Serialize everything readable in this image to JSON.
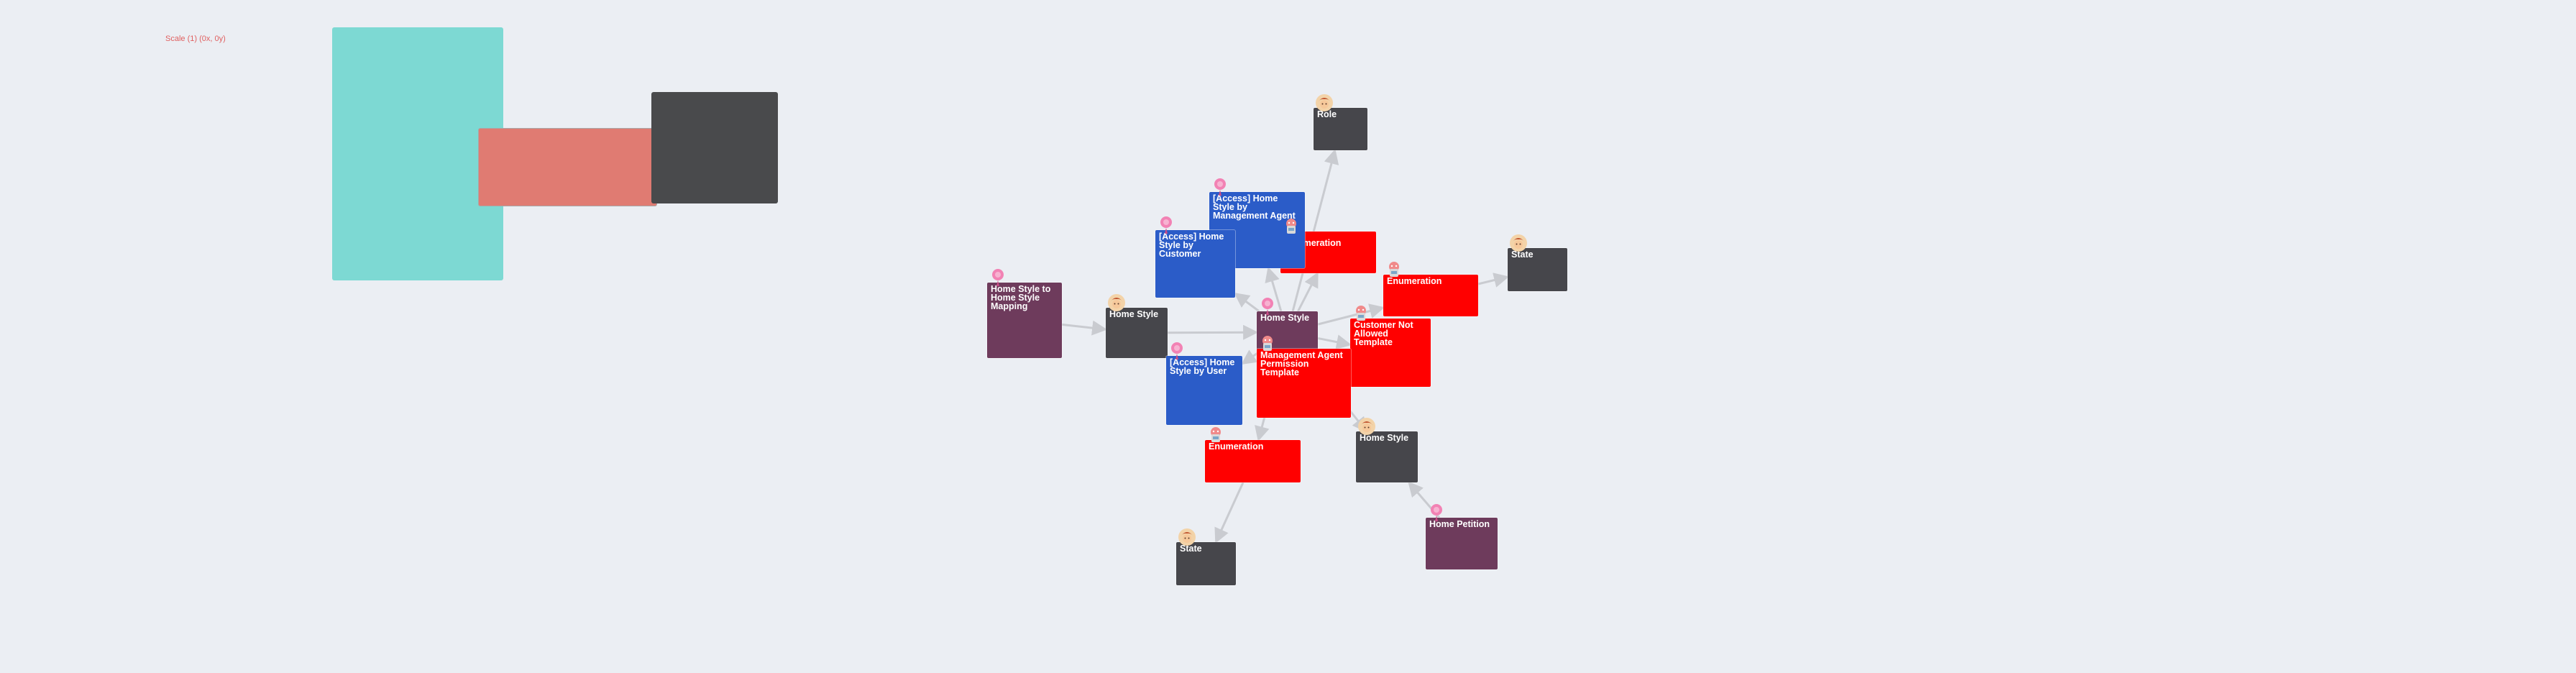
{
  "scale_label": "Scale (1) (0x, 0y)",
  "colors": {
    "background": "#ebeef3",
    "zone_teal": "#7dd9d3",
    "zone_salmon": "#e07b72",
    "zone_dark": "#494a4c",
    "node_dark": "#46464b",
    "node_red": "#ff0000",
    "node_blue": "#2b5cc8",
    "node_plum": "#6e3b5c",
    "edge": "#c9cbd0"
  },
  "nodes": {
    "role": {
      "label": "Role",
      "icon": "user-avatar-icon"
    },
    "access_management_agent": {
      "label": "[Access] Home Style by Management Agent",
      "icon": "pin-avatar-icon"
    },
    "access_customer": {
      "label": "[Access] Home Style by Customer",
      "icon": "pin-avatar-icon"
    },
    "enumeration_top": {
      "label": "Enumeration",
      "icon": "robot-avatar-icon"
    },
    "enumeration_right": {
      "label": "Enumeration",
      "icon": "robot-avatar-icon"
    },
    "state_right": {
      "label": "State",
      "icon": "user-avatar-icon"
    },
    "home_style_mapping": {
      "label": "Home Style to Home Style Mapping",
      "icon": "pin-avatar-icon"
    },
    "home_style_left": {
      "label": "Home Style",
      "icon": "user-avatar-icon"
    },
    "home_style_center": {
      "label": "Home Style",
      "icon": "pin-avatar-icon"
    },
    "customer_not_allowed": {
      "label": "Customer Not Allowed Template",
      "icon": "robot-avatar-icon"
    },
    "access_user": {
      "label": "[Access] Home Style by User",
      "icon": "pin-avatar-icon"
    },
    "management_agent_permission": {
      "label": "Management Agent Permission Template",
      "icon": "robot-avatar-icon"
    },
    "home_style_bottom": {
      "label": "Home Style",
      "icon": "user-avatar-icon"
    },
    "enumeration_bottom": {
      "label": "Enumeration",
      "icon": "robot-avatar-icon"
    },
    "home_petition": {
      "label": "Home Petition",
      "icon": "pin-avatar-icon"
    },
    "state_bottom": {
      "label": "State",
      "icon": "user-avatar-icon"
    }
  },
  "edges": [
    [
      "home_style_center",
      "role"
    ],
    [
      "home_style_center",
      "access_management_agent"
    ],
    [
      "home_style_center",
      "access_customer"
    ],
    [
      "home_style_center",
      "enumeration_top"
    ],
    [
      "home_style_center",
      "enumeration_right"
    ],
    [
      "home_style_center",
      "customer_not_allowed"
    ],
    [
      "home_style_center",
      "access_user"
    ],
    [
      "home_style_center",
      "management_agent_permission"
    ],
    [
      "home_style_center",
      "home_style_bottom"
    ],
    [
      "home_style_center",
      "enumeration_bottom"
    ],
    [
      "home_style_left",
      "home_style_center"
    ],
    [
      "home_style_mapping",
      "home_style_left"
    ],
    [
      "enumeration_right",
      "state_right"
    ],
    [
      "enumeration_bottom",
      "state_bottom"
    ],
    [
      "home_petition",
      "home_style_bottom"
    ]
  ]
}
